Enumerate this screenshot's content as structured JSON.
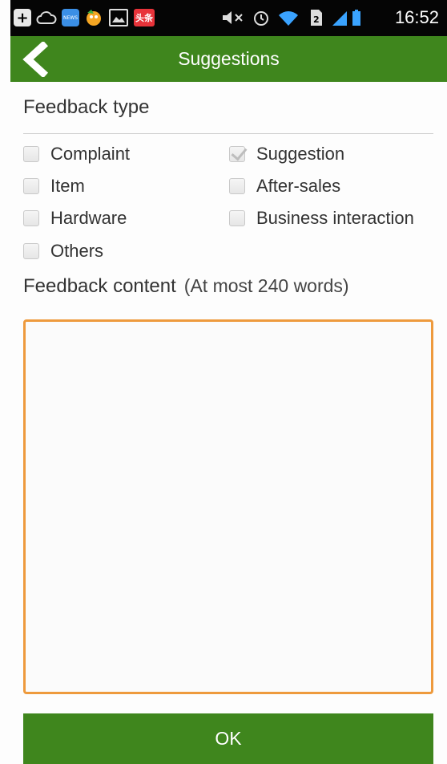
{
  "status_bar": {
    "time": "16:52",
    "news_badge": "NEWS",
    "toutiao_badge": "头条",
    "icons": [
      "add-icon",
      "cloud-icon",
      "news-app-icon",
      "game-app-icon",
      "gallery-icon",
      "toutiao-app-icon",
      "mute-icon",
      "alarm-icon",
      "wifi-icon",
      "sim-icon",
      "signal-icon",
      "battery-icon"
    ]
  },
  "header": {
    "title": "Suggestions",
    "back_icon": "chevron-left-icon"
  },
  "feedback_type": {
    "label": "Feedback type",
    "options": [
      {
        "label": "Complaint",
        "checked": false
      },
      {
        "label": "Suggestion",
        "checked": true
      },
      {
        "label": "Item",
        "checked": false
      },
      {
        "label": "After-sales",
        "checked": false
      },
      {
        "label": "Hardware",
        "checked": false
      },
      {
        "label": "Business interaction",
        "checked": false
      },
      {
        "label": "Others",
        "checked": false
      }
    ]
  },
  "feedback_content": {
    "label": "Feedback content",
    "hint": "(At most 240 words)",
    "value": "",
    "placeholder": ""
  },
  "actions": {
    "ok_label": "OK"
  },
  "colors": {
    "brand_green": "#3f861d",
    "textarea_border": "#ee9a3d",
    "status_bar_bg": "#050505"
  }
}
